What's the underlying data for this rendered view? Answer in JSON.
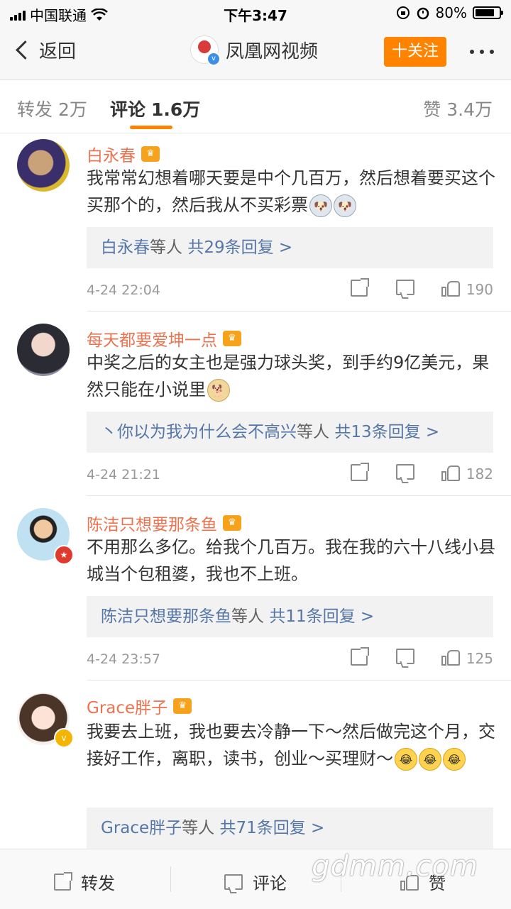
{
  "status_bar": {
    "carrier": "中国联通",
    "time": "下午3:47",
    "battery": "80%",
    "battery_level": 0.8
  },
  "nav": {
    "back_label": "返回",
    "title": "凤凰网视频",
    "follow_label": "十关注"
  },
  "tabs": [
    {
      "label": "转发",
      "count": "2万"
    },
    {
      "label": "评论",
      "count": "1.6万"
    },
    {
      "label": "赞",
      "count": "3.4万"
    }
  ],
  "comments": [
    {
      "user": "白永春",
      "text": "我常常幻想着哪天要是中个几百万，然后想着要买这个买那个的，然后我从不买彩票",
      "emoji": [
        "husky",
        "husky"
      ],
      "reply_user": "白永春",
      "reply_mid": "等人",
      "reply_count": "共29条回复 >",
      "date": "4-24 22:04",
      "likes": "190"
    },
    {
      "user": "每天都要爱坤一点",
      "text": "中奖之后的女主也是强力球头奖，到手约9亿美元，果然只能在小说里",
      "emoji": [
        "doge"
      ],
      "reply_user": "丶你以为我为什么会不高兴",
      "reply_mid": "等人",
      "reply_count": "共13条回复 >",
      "date": "4-24 21:21",
      "likes": "182"
    },
    {
      "user": "陈洁只想要那条鱼",
      "text": "不用那么多亿。给我个几百万。我在我的六十八线小县城当个包租婆，我也不上班。",
      "emoji": [],
      "reply_user": "陈洁只想要那条鱼",
      "reply_mid": "等人",
      "reply_count": "共11条回复 >",
      "date": "4-24 23:57",
      "likes": "125"
    },
    {
      "user": "Grace胖子",
      "text": "我要去上班，我也要去冷静一下～然后做完这个月，交接好工作，离职，读书，创业～买理财～",
      "emoji": [
        "cry",
        "cry",
        "cry"
      ],
      "reply_user": "Grace胖子",
      "reply_mid": "等人",
      "reply_count": "共71条回复 >",
      "date": "",
      "likes": ""
    }
  ],
  "bottom_bar": {
    "repost": "转发",
    "comment": "评论",
    "like": "赞"
  },
  "watermark": "gdmm.com",
  "colors": {
    "accent": "#ff8200",
    "username": "#eb7350",
    "link": "#5576a7"
  }
}
